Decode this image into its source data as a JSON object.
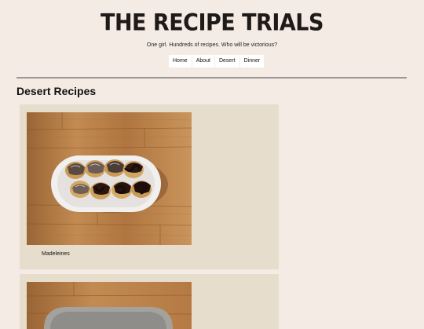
{
  "header": {
    "title": "THE RECIPE TRIALS",
    "tagline": "One girl. Hundreds of recipes. Who will be victorious?"
  },
  "nav": {
    "items": [
      {
        "label": "Home"
      },
      {
        "label": "About"
      },
      {
        "label": "Desert"
      },
      {
        "label": "Dinner"
      }
    ]
  },
  "main": {
    "section_title": "Desert Recipes",
    "recipes": [
      {
        "caption": "Madeleines",
        "image": "madeleines-photo"
      },
      {
        "caption": "",
        "image": "recipe-photo"
      }
    ]
  },
  "colors": {
    "background": "#f4ebe4",
    "card": "#e7ddcd",
    "divider": "#9c9794",
    "wood": "#b8824a"
  }
}
